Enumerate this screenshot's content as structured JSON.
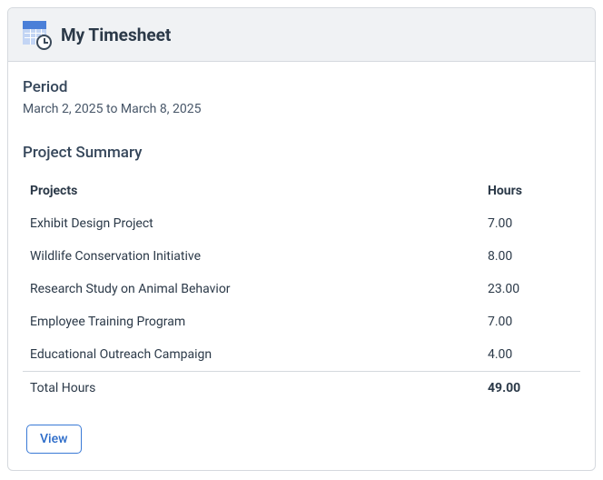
{
  "header": {
    "title": "My Timesheet"
  },
  "period": {
    "label": "Period",
    "text": "March 2, 2025 to March 8, 2025"
  },
  "summary": {
    "title": "Project Summary",
    "columns": {
      "projects": "Projects",
      "hours": "Hours"
    },
    "rows": [
      {
        "name": "Exhibit Design Project",
        "hours": "7.00"
      },
      {
        "name": "Wildlife Conservation Initiative",
        "hours": "8.00"
      },
      {
        "name": "Research Study on Animal Behavior",
        "hours": "23.00"
      },
      {
        "name": "Employee Training Program",
        "hours": "7.00"
      },
      {
        "name": "Educational Outreach Campaign",
        "hours": "4.00"
      }
    ],
    "total": {
      "label": "Total Hours",
      "hours": "49.00"
    }
  },
  "actions": {
    "view": "View"
  }
}
